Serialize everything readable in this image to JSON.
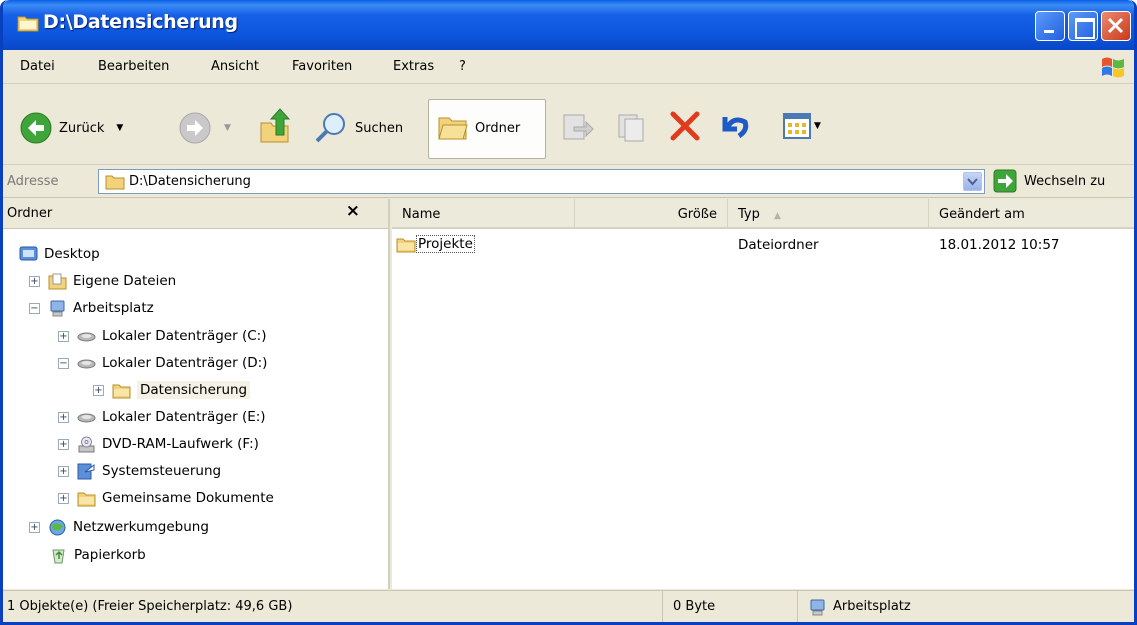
{
  "window": {
    "title": "D:\\Datensicherung",
    "title_color": "#0a5fe8"
  },
  "menu": {
    "items": [
      "Datei",
      "Bearbeiten",
      "Ansicht",
      "Favoriten",
      "Extras",
      "?"
    ]
  },
  "toolbar": {
    "back_label": "Zurück",
    "search_label": "Suchen",
    "folders_label": "Ordner"
  },
  "address": {
    "label": "Adresse",
    "value": "D:\\Datensicherung",
    "go_label": "Wechseln zu"
  },
  "folder_pane": {
    "title": "Ordner",
    "close": "×",
    "tree": [
      {
        "label": "Desktop",
        "icon": "desktop-icon",
        "expander": ""
      },
      {
        "label": "Eigene Dateien",
        "icon": "my-documents-icon",
        "expander": "+"
      },
      {
        "label": "Arbeitsplatz",
        "icon": "my-computer-icon",
        "expander": "−"
      },
      {
        "label": "Lokaler Datenträger (C:)",
        "icon": "drive-icon",
        "expander": "+"
      },
      {
        "label": "Lokaler Datenträger (D:)",
        "icon": "drive-icon",
        "expander": "−"
      },
      {
        "label": "Datensicherung",
        "icon": "folder-icon",
        "expander": "+"
      },
      {
        "label": "Lokaler Datenträger (E:)",
        "icon": "drive-icon",
        "expander": "+"
      },
      {
        "label": "DVD-RAM-Laufwerk (F:)",
        "icon": "dvd-drive-icon",
        "expander": "+"
      },
      {
        "label": "Systemsteuerung",
        "icon": "control-panel-icon",
        "expander": "+"
      },
      {
        "label": "Gemeinsame Dokumente",
        "icon": "folder-icon",
        "expander": "+"
      },
      {
        "label": "Netzwerkumgebung",
        "icon": "network-icon",
        "expander": "+"
      },
      {
        "label": "Papierkorb",
        "icon": "recycle-bin-icon",
        "expander": ""
      }
    ]
  },
  "file_list": {
    "columns": [
      "Name",
      "Größe",
      "Typ",
      "Geändert am"
    ],
    "rows": [
      {
        "name": "Projekte",
        "size": "",
        "type": "Dateiordner",
        "modified": "18.01.2012 10:57"
      }
    ]
  },
  "status": {
    "objects": "1 Objekte(e) (Freier Speicherplatz: 49,6 GB)",
    "size": "0 Byte",
    "location": "Arbeitsplatz"
  }
}
